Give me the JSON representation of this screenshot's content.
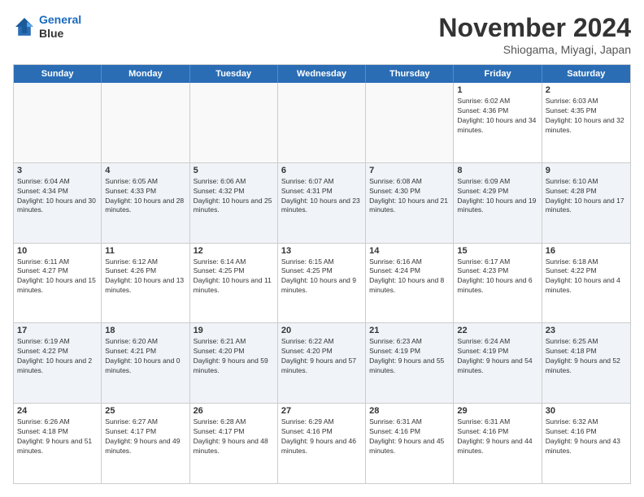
{
  "logo": {
    "line1": "General",
    "line2": "Blue"
  },
  "header": {
    "month": "November 2024",
    "location": "Shiogama, Miyagi, Japan"
  },
  "weekdays": [
    "Sunday",
    "Monday",
    "Tuesday",
    "Wednesday",
    "Thursday",
    "Friday",
    "Saturday"
  ],
  "rows": [
    [
      {
        "day": "",
        "info": ""
      },
      {
        "day": "",
        "info": ""
      },
      {
        "day": "",
        "info": ""
      },
      {
        "day": "",
        "info": ""
      },
      {
        "day": "",
        "info": ""
      },
      {
        "day": "1",
        "info": "Sunrise: 6:02 AM\nSunset: 4:36 PM\nDaylight: 10 hours and 34 minutes."
      },
      {
        "day": "2",
        "info": "Sunrise: 6:03 AM\nSunset: 4:35 PM\nDaylight: 10 hours and 32 minutes."
      }
    ],
    [
      {
        "day": "3",
        "info": "Sunrise: 6:04 AM\nSunset: 4:34 PM\nDaylight: 10 hours and 30 minutes."
      },
      {
        "day": "4",
        "info": "Sunrise: 6:05 AM\nSunset: 4:33 PM\nDaylight: 10 hours and 28 minutes."
      },
      {
        "day": "5",
        "info": "Sunrise: 6:06 AM\nSunset: 4:32 PM\nDaylight: 10 hours and 25 minutes."
      },
      {
        "day": "6",
        "info": "Sunrise: 6:07 AM\nSunset: 4:31 PM\nDaylight: 10 hours and 23 minutes."
      },
      {
        "day": "7",
        "info": "Sunrise: 6:08 AM\nSunset: 4:30 PM\nDaylight: 10 hours and 21 minutes."
      },
      {
        "day": "8",
        "info": "Sunrise: 6:09 AM\nSunset: 4:29 PM\nDaylight: 10 hours and 19 minutes."
      },
      {
        "day": "9",
        "info": "Sunrise: 6:10 AM\nSunset: 4:28 PM\nDaylight: 10 hours and 17 minutes."
      }
    ],
    [
      {
        "day": "10",
        "info": "Sunrise: 6:11 AM\nSunset: 4:27 PM\nDaylight: 10 hours and 15 minutes."
      },
      {
        "day": "11",
        "info": "Sunrise: 6:12 AM\nSunset: 4:26 PM\nDaylight: 10 hours and 13 minutes."
      },
      {
        "day": "12",
        "info": "Sunrise: 6:14 AM\nSunset: 4:25 PM\nDaylight: 10 hours and 11 minutes."
      },
      {
        "day": "13",
        "info": "Sunrise: 6:15 AM\nSunset: 4:25 PM\nDaylight: 10 hours and 9 minutes."
      },
      {
        "day": "14",
        "info": "Sunrise: 6:16 AM\nSunset: 4:24 PM\nDaylight: 10 hours and 8 minutes."
      },
      {
        "day": "15",
        "info": "Sunrise: 6:17 AM\nSunset: 4:23 PM\nDaylight: 10 hours and 6 minutes."
      },
      {
        "day": "16",
        "info": "Sunrise: 6:18 AM\nSunset: 4:22 PM\nDaylight: 10 hours and 4 minutes."
      }
    ],
    [
      {
        "day": "17",
        "info": "Sunrise: 6:19 AM\nSunset: 4:22 PM\nDaylight: 10 hours and 2 minutes."
      },
      {
        "day": "18",
        "info": "Sunrise: 6:20 AM\nSunset: 4:21 PM\nDaylight: 10 hours and 0 minutes."
      },
      {
        "day": "19",
        "info": "Sunrise: 6:21 AM\nSunset: 4:20 PM\nDaylight: 9 hours and 59 minutes."
      },
      {
        "day": "20",
        "info": "Sunrise: 6:22 AM\nSunset: 4:20 PM\nDaylight: 9 hours and 57 minutes."
      },
      {
        "day": "21",
        "info": "Sunrise: 6:23 AM\nSunset: 4:19 PM\nDaylight: 9 hours and 55 minutes."
      },
      {
        "day": "22",
        "info": "Sunrise: 6:24 AM\nSunset: 4:19 PM\nDaylight: 9 hours and 54 minutes."
      },
      {
        "day": "23",
        "info": "Sunrise: 6:25 AM\nSunset: 4:18 PM\nDaylight: 9 hours and 52 minutes."
      }
    ],
    [
      {
        "day": "24",
        "info": "Sunrise: 6:26 AM\nSunset: 4:18 PM\nDaylight: 9 hours and 51 minutes."
      },
      {
        "day": "25",
        "info": "Sunrise: 6:27 AM\nSunset: 4:17 PM\nDaylight: 9 hours and 49 minutes."
      },
      {
        "day": "26",
        "info": "Sunrise: 6:28 AM\nSunset: 4:17 PM\nDaylight: 9 hours and 48 minutes."
      },
      {
        "day": "27",
        "info": "Sunrise: 6:29 AM\nSunset: 4:16 PM\nDaylight: 9 hours and 46 minutes."
      },
      {
        "day": "28",
        "info": "Sunrise: 6:31 AM\nSunset: 4:16 PM\nDaylight: 9 hours and 45 minutes."
      },
      {
        "day": "29",
        "info": "Sunrise: 6:31 AM\nSunset: 4:16 PM\nDaylight: 9 hours and 44 minutes."
      },
      {
        "day": "30",
        "info": "Sunrise: 6:32 AM\nSunset: 4:16 PM\nDaylight: 9 hours and 43 minutes."
      }
    ]
  ]
}
